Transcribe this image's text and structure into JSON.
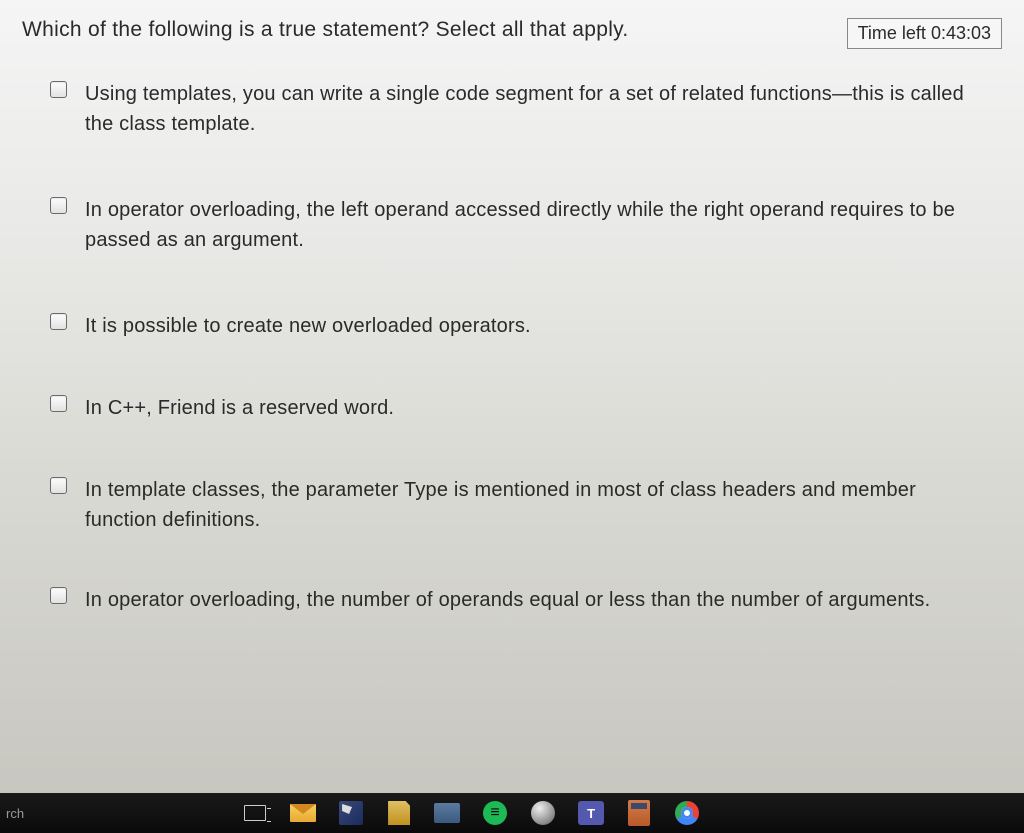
{
  "question": {
    "prompt": "Which of the following is a true statement? Select all that apply.",
    "options": [
      "Using templates, you can write a single code segment for a set of related functions—this is called the class template.",
      "In operator overloading, the left operand accessed directly while the right operand requires to be passed as an argument.",
      "It is possible to create new overloaded operators.",
      "In C++, Friend is a reserved word.",
      "In template classes, the parameter Type is mentioned in most of class headers and member function definitions.",
      "In operator overloading, the number of operands equal or less than the number of arguments."
    ]
  },
  "timer": {
    "label": "Time left 0:43:03"
  },
  "taskbar": {
    "search": "rch"
  }
}
